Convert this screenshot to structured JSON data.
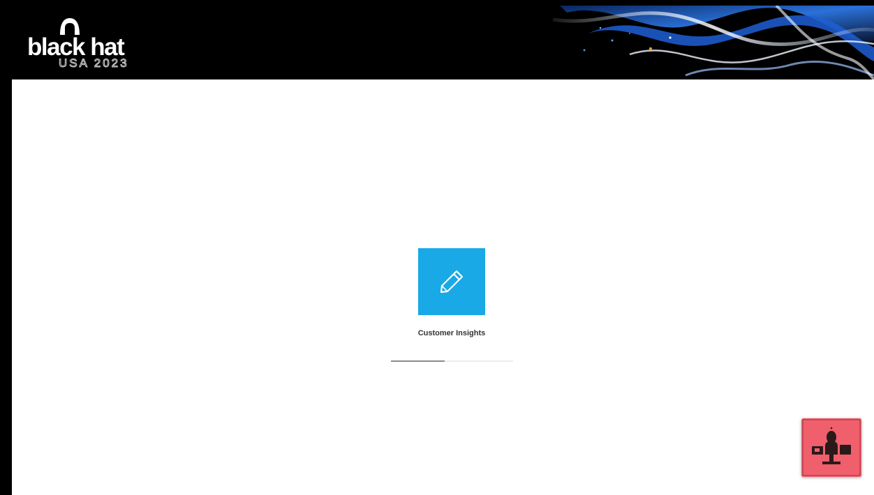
{
  "banner": {
    "logo_text": "black hat",
    "logo_subtitle": "USA 2023"
  },
  "app_tile": {
    "label": "Customer Insights",
    "icon": "pencil-icon",
    "color": "#18a9e6"
  },
  "loading": {
    "progress": 0.44
  },
  "assistant_button": {
    "icon": "assistant-avatar-icon",
    "color": "#ef5f6c"
  }
}
